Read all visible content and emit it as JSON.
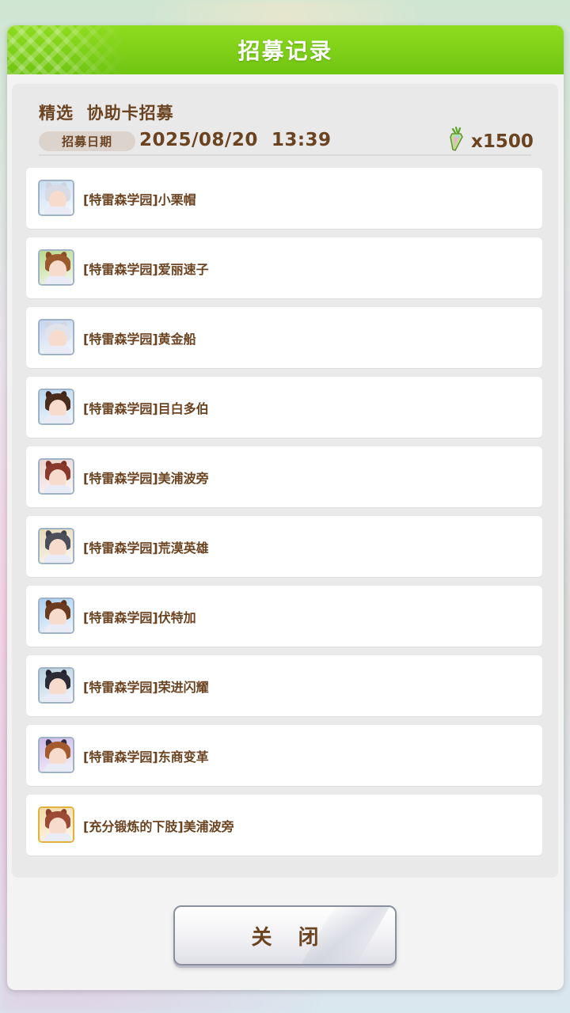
{
  "dialog": {
    "title": "招募记录",
    "gacha_name": "精选  协助卡招募",
    "date_label": "招募日期",
    "date_value": "2025/08/20  13:39",
    "cost_icon": "carrot-crystal-icon",
    "cost_value": "x1500",
    "close_label": "关 闭"
  },
  "records": [
    {
      "label": "[特雷森学园]小栗帽",
      "icon": "character-portrait-icon",
      "bg": "#c9def2",
      "hair": "#d9dbe4",
      "ear": "#cfd3de",
      "frame": "silver"
    },
    {
      "label": "[特雷森学园]爱丽速子",
      "icon": "character-portrait-icon",
      "bg": "#b9d98e",
      "hair": "#9a5a2d",
      "ear": "#8a4d24",
      "frame": "silver"
    },
    {
      "label": "[特雷森学园]黄金船",
      "icon": "character-portrait-icon",
      "bg": "#c4d5ef",
      "hair": "#e2e3ea",
      "ear": "#d3d5de",
      "frame": "silver"
    },
    {
      "label": "[特雷森学园]目白多伯",
      "icon": "character-portrait-icon",
      "bg": "#b7d6ee",
      "hair": "#4a2c1d",
      "ear": "#3f2418",
      "frame": "silver"
    },
    {
      "label": "[特雷森学园]美浦波旁",
      "icon": "character-portrait-icon",
      "bg": "#e9d4d0",
      "hair": "#8a3a2c",
      "ear": "#7a3024",
      "frame": "silver"
    },
    {
      "label": "[特雷森学园]荒漠英雄",
      "icon": "character-portrait-icon",
      "bg": "#e6d8b6",
      "hair": "#4c4f5b",
      "ear": "#3f424d",
      "frame": "silver"
    },
    {
      "label": "[特雷森学园]伏特加",
      "icon": "character-portrait-icon",
      "bg": "#a9cfee",
      "hair": "#6a3b1f",
      "ear": "#5a3018",
      "frame": "silver"
    },
    {
      "label": "[特雷森学园]荣进闪耀",
      "icon": "character-portrait-icon",
      "bg": "#b8cfe0",
      "hair": "#2b2a36",
      "ear": "#22212b",
      "frame": "silver"
    },
    {
      "label": "[特雷森学园]东商变革",
      "icon": "character-portrait-icon",
      "bg": "#cbb8e6",
      "hair": "#a35a2f",
      "ear": "#2f2a3e",
      "frame": "silver"
    },
    {
      "label": "[充分锻炼的下肢]美浦波旁",
      "icon": "support-card-portrait-icon",
      "bg": "#f2d9a6",
      "hair": "#9c4a36",
      "ear": "#8a3e2c",
      "frame": "gold"
    }
  ]
}
